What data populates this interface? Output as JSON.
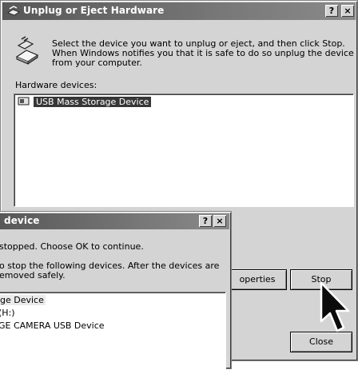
{
  "main_dialog": {
    "title": "Unplug or Eject Hardware",
    "help_button": "?",
    "close_x": "×",
    "description": "Select the device you want to unplug or eject, and then click Stop. When Windows notifies you that it is safe to do so unplug the device from your computer.",
    "hardware_label": "Hardware devices:",
    "devices": [
      "USB Mass Storage Device"
    ],
    "properties_button": "operties",
    "stop_button": "Stop",
    "close_button": "Close"
  },
  "stop_dialog": {
    "title": "device",
    "help_button": "?",
    "close_x": "×",
    "line1": "stopped. Choose OK to continue.",
    "line2": "o stop the following devices. After the devices are",
    "line3": "emoved safely.",
    "devices": [
      "ge Device",
      "(H:)",
      "GE  CAMERA USB Device"
    ]
  }
}
